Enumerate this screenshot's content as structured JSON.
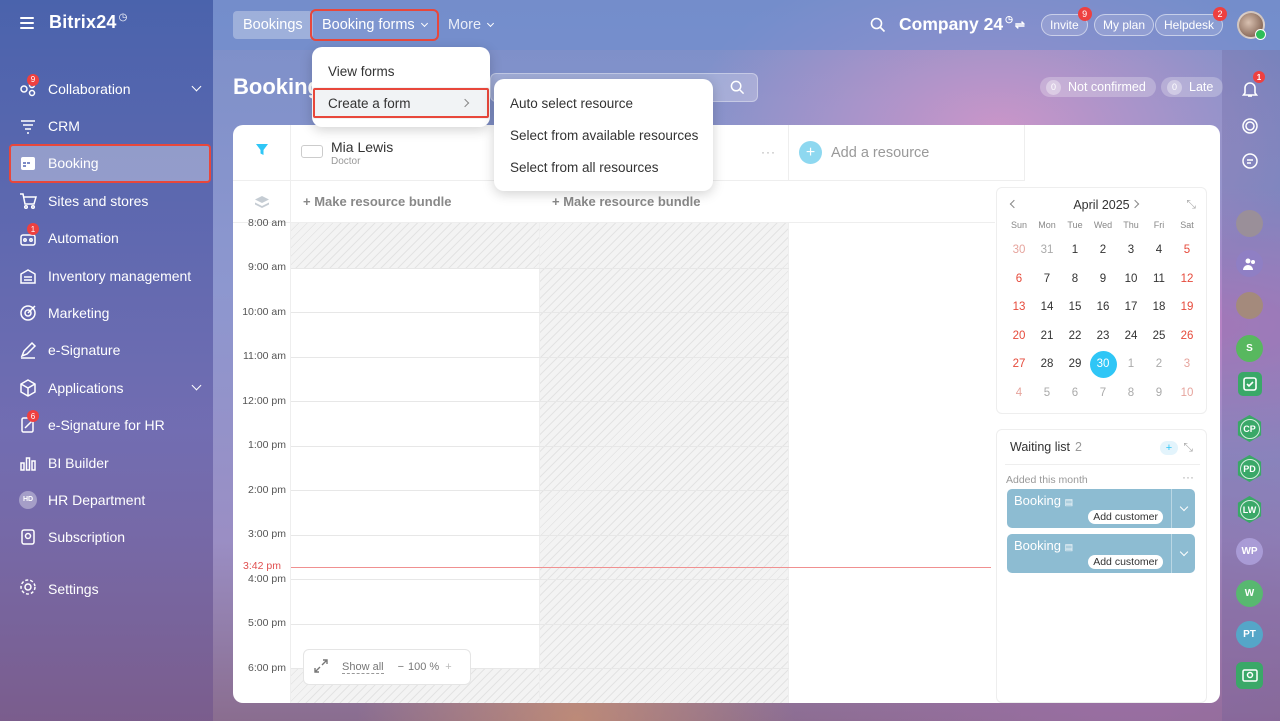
{
  "brand": {
    "name": "Bitrix24",
    "mark": "◷"
  },
  "sidebar": {
    "items": [
      {
        "label": "Collaboration",
        "badge": "9"
      },
      {
        "label": "CRM"
      },
      {
        "label": "Booking"
      },
      {
        "label": "Sites and stores"
      },
      {
        "label": "Automation",
        "badge": "1"
      },
      {
        "label": "Inventory management"
      },
      {
        "label": "Marketing"
      },
      {
        "label": "e-Signature"
      },
      {
        "label": "Applications"
      },
      {
        "label": "e-Signature for HR",
        "badge": "6"
      },
      {
        "label": "BI Builder"
      },
      {
        "label": "HR Department",
        "initials": "HD"
      },
      {
        "label": "Subscription"
      }
    ],
    "settings": "Settings"
  },
  "topbar": {
    "tabs": [
      "Bookings",
      "Booking forms",
      "More"
    ],
    "company": "Company 24",
    "invite": "Invite",
    "invite_badge": "9",
    "plan": "My plan",
    "helpdesk": "Helpdesk",
    "helpdesk_badge": "2"
  },
  "page": {
    "title": "Booking",
    "not_confirmed_count": "0",
    "not_confirmed": "Not confirmed",
    "late_count": "0",
    "late": "Late"
  },
  "forms_menu": {
    "view": "View forms",
    "create": "Create a form"
  },
  "create_submenu": [
    "Auto select resource",
    "Select from available resources",
    "Select from all resources"
  ],
  "resource": {
    "name": "Mia Lewis",
    "role": "Doctor",
    "add": "Add a resource",
    "bundle": "+ Make resource bundle"
  },
  "times": [
    "8:00 am",
    "9:00 am",
    "10:00 am",
    "11:00 am",
    "12:00 pm",
    "1:00 pm",
    "2:00 pm",
    "3:00 pm",
    "4:00 pm",
    "5:00 pm",
    "6:00 pm"
  ],
  "now": "3:42 pm",
  "zoom": {
    "show_all": "Show all",
    "minus": "−",
    "pct": "100 %",
    "plus": "+"
  },
  "calendar": {
    "title": "April 2025",
    "weekdays": [
      "Sun",
      "Mon",
      "Tue",
      "Wed",
      "Thu",
      "Fri",
      "Sat"
    ],
    "days": [
      "30",
      "31",
      "1",
      "2",
      "3",
      "4",
      "5",
      "6",
      "7",
      "8",
      "9",
      "10",
      "11",
      "12",
      "13",
      "14",
      "15",
      "16",
      "17",
      "18",
      "19",
      "20",
      "21",
      "22",
      "23",
      "24",
      "25",
      "26",
      "27",
      "28",
      "29",
      "30",
      "1",
      "2",
      "3",
      "4",
      "5",
      "6",
      "7",
      "8",
      "9",
      "10"
    ],
    "selected": "30"
  },
  "waiting": {
    "title": "Waiting list",
    "count": "2",
    "sub": "Added this month",
    "cards": [
      {
        "label": "Booking",
        "action": "Add customer"
      },
      {
        "label": "Booking",
        "action": "Add customer"
      }
    ]
  },
  "right_rail": {
    "notif_badge": "1",
    "initials": [
      "S",
      "CP",
      "PD",
      "LW",
      "WP",
      "W",
      "PT"
    ]
  },
  "colors": {
    "accent": "#2fc6f6",
    "highlight": "#e8473b",
    "waiting_card": "#8dbcd2"
  }
}
